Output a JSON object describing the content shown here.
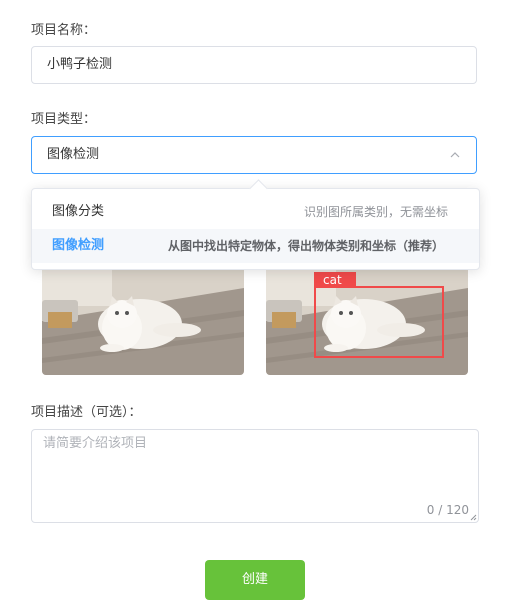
{
  "form": {
    "name": {
      "label": "项目名称：",
      "value": "小鸭子检测"
    },
    "type": {
      "label": "项目类型：",
      "selected": "图像检测",
      "options": [
        {
          "name": "图像分类",
          "desc": "识别图所属类别，无需坐标"
        },
        {
          "name": "图像检测",
          "desc": "从图中找出特定物体，得出物体类别和坐标（推荐）"
        }
      ],
      "preview_detection_label": "cat"
    },
    "description": {
      "label": "项目描述（可选）：",
      "placeholder": "请简要介绍该项目",
      "counter": "0 / 120"
    },
    "submit_label": "创建"
  },
  "colors": {
    "primary": "#409eff",
    "success": "#67c23a",
    "detection_box": "#f04a4a"
  },
  "icons": {
    "select_arrow": "chevron-up-icon",
    "textarea_resize": "resize-grip-icon"
  }
}
